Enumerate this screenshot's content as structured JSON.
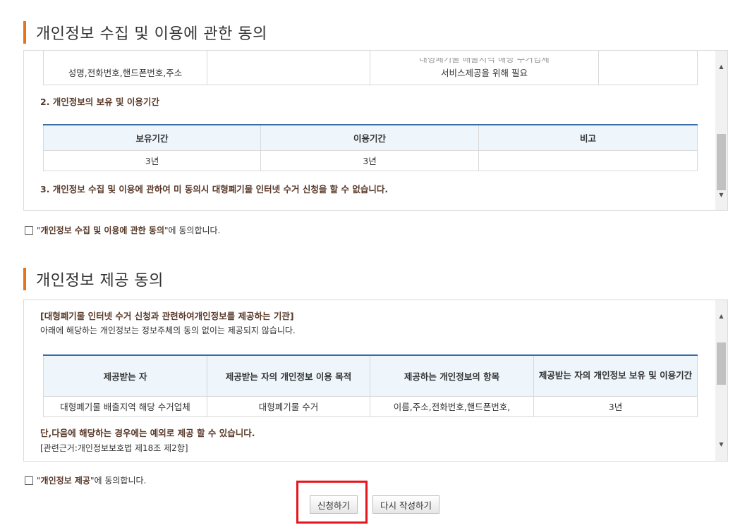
{
  "section1": {
    "title": "개인정보 수집 및 이용에 관한 동의",
    "partial_row": {
      "col1": "성명,전화번호,핸드폰번호,주소",
      "col3_line1": "대형폐기물 배출지역 해당 수거업체",
      "col3_line2": "서비스제공을 위해 필요"
    },
    "heading2": "2. 개인정보의 보유 및 이용기간",
    "table_headers": [
      "보유기간",
      "이용기간",
      "비고"
    ],
    "table_row": [
      "3년",
      "3년",
      ""
    ],
    "heading3": "3. 개인정보 수집 및 이용에 관하여 미 동의시 대형폐기물 인터넷 수거 신청을 할 수 없습니다.",
    "agree_quote_open": "\"",
    "agree_bold": "개인정보 수집 및 이용에 관한 동의",
    "agree_rest": "\"에 동의합니다."
  },
  "section2": {
    "title": "개인정보 제공 동의",
    "heading": "[대형폐기물 인터넷 수거 신청과 관련하여개인정보를 제공하는 기관]",
    "note": "아래에 해당하는 개인정보는 정보주체의 동의 없이는 제공되지 않습니다.",
    "table_headers": [
      "제공받는 자",
      "제공받는 자의 개인정보 이용 목적",
      "제공하는 개인정보의 항목",
      "제공받는 자의 개인정보 보유 및 이용기간"
    ],
    "table_row": [
      "대형폐기물 배출지역 해당 수거업체",
      "대형폐기물 수거",
      "이름,주소,전화번호,핸드폰번호,",
      "3년"
    ],
    "exception": "단,다음에 해당하는 경우에는 예외로 제공 할 수 있습니다.",
    "basis": "[관련근거:개인정보보호법 제18조 제2항]",
    "agree_quote_open": "\"",
    "agree_bold": "개인정보 제공",
    "agree_rest": "\"에 동의합니다."
  },
  "buttons": {
    "submit": "신청하기",
    "reset": "다시 작성하기"
  },
  "colors": {
    "accent": "#e8741a",
    "highlight": "#e8141b",
    "table_top": "#3a6ca8"
  }
}
